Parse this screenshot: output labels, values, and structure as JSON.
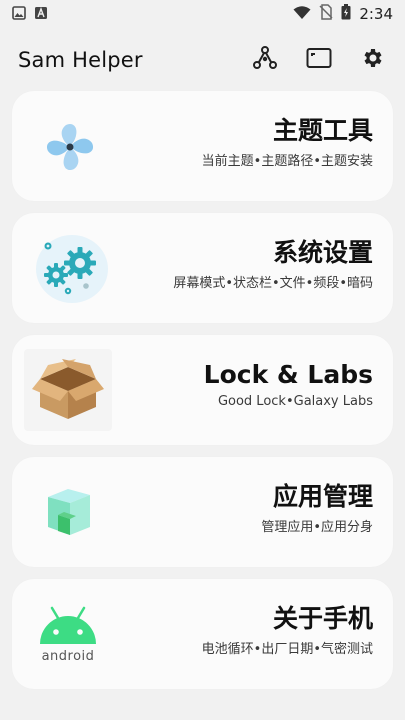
{
  "status_bar": {
    "time": "2:34",
    "left_icons": [
      "image-icon",
      "app-a-icon"
    ],
    "right_icons": [
      "wifi-icon",
      "no-sim-icon",
      "battery-charging-icon"
    ]
  },
  "app_bar": {
    "title": "Sam Helper",
    "actions": [
      "share-nodes-icon",
      "screen-icon",
      "gear-icon"
    ]
  },
  "cards": [
    {
      "title": "主题工具",
      "subtitle": "当前主题•主题路径•主题安装",
      "icon": "pinwheel-icon"
    },
    {
      "title": "系统设置",
      "subtitle": "屏幕模式•状态栏•文件•频段•暗码",
      "icon": "gears-icon"
    },
    {
      "title": "Lock & Labs",
      "subtitle": "Good Lock•Galaxy Labs",
      "icon": "box-icon"
    },
    {
      "title": "应用管理",
      "subtitle": "管理应用•应用分身",
      "icon": "cube-icon"
    },
    {
      "title": "关于手机",
      "subtitle": "电池循环•出厂日期•气密测试",
      "icon": "android-icon"
    }
  ],
  "android_logo_text": "android",
  "colors": {
    "background": "#f1f1f1",
    "card": "#fbfbfb",
    "android_green": "#3ddc84",
    "pinwheel_blue": "#8ec8ee",
    "gear_teal": "#2aa9b8",
    "box_brown": "#c99a62",
    "cube_green": "#5fd08a"
  }
}
